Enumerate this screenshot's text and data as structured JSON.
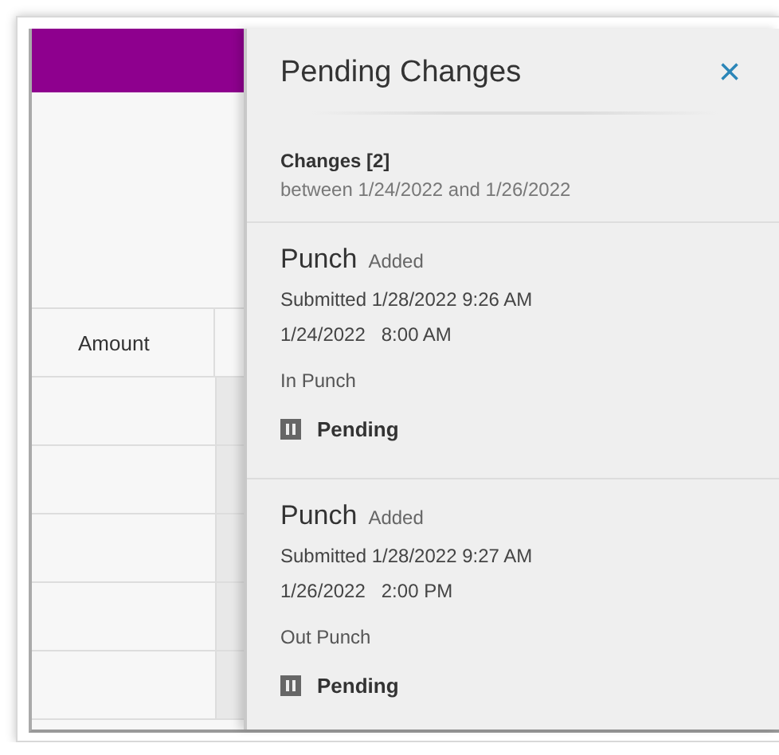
{
  "background_table": {
    "columns": [
      "Amount"
    ]
  },
  "panel": {
    "title": "Pending Changes",
    "close": "×",
    "summary": {
      "title": "Changes [2]",
      "range": "between 1/24/2022 and 1/26/2022"
    },
    "changes": [
      {
        "type": "Punch",
        "action": "Added",
        "submitted": "Submitted 1/28/2022 9:26 AM",
        "datetime": "1/24/2022   8:00 AM",
        "description": "In Punch",
        "status": "Pending"
      },
      {
        "type": "Punch",
        "action": "Added",
        "submitted": "Submitted 1/28/2022 9:27 AM",
        "datetime": "1/26/2022   2:00 PM",
        "description": "Out Punch",
        "status": "Pending"
      }
    ]
  }
}
